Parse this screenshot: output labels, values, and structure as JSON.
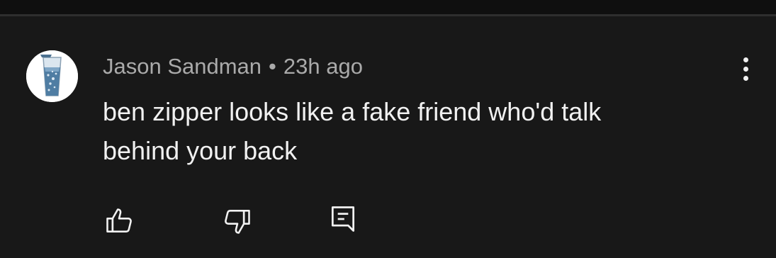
{
  "comment": {
    "author": "Jason Sandman",
    "separator": "•",
    "timestamp": "23h ago",
    "text_line1": "ben zipper looks like a fake friend who'd talk",
    "text_line2": "behind your back"
  },
  "icons": {
    "avatar": "glass-of-water-icon",
    "more": "more-vertical-icon",
    "like": "thumbs-up-icon",
    "dislike": "thumbs-down-icon",
    "reply": "reply-comment-icon"
  },
  "colors": {
    "background": "#181818",
    "text_primary": "#f1f1f1",
    "text_secondary": "#aaaaaa"
  }
}
